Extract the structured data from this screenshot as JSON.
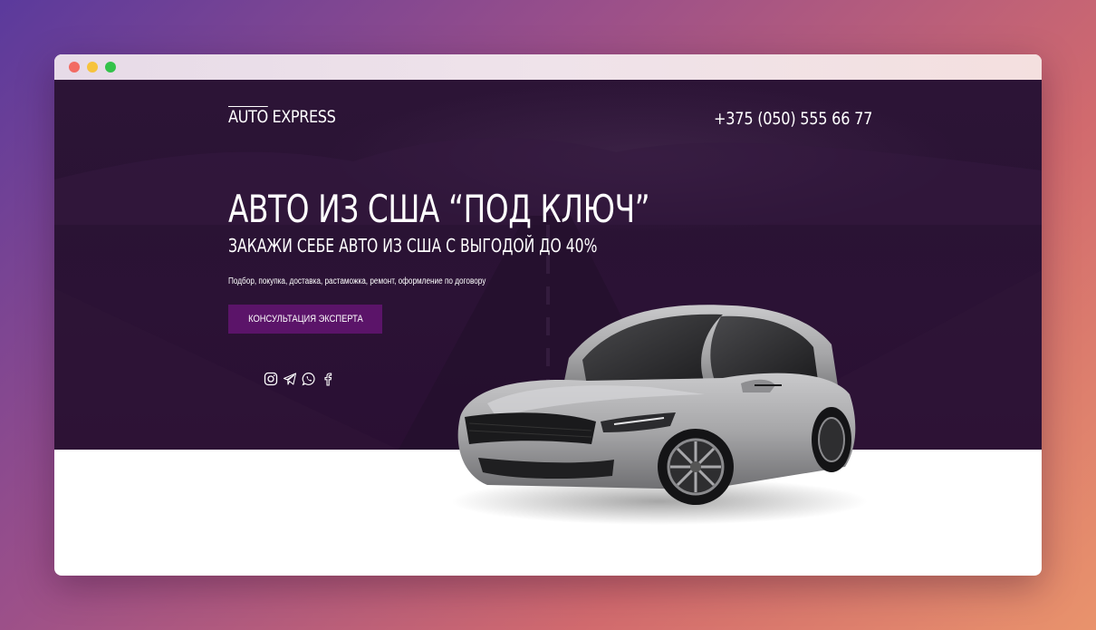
{
  "site": {
    "logo": {
      "part1": "AUTO",
      "part2": " EXPRESS"
    },
    "phone": "+375 (050) 555 66 77"
  },
  "hero": {
    "headline": "АВТО ИЗ США “ПОД КЛЮЧ”",
    "subheadline": "ЗАКАЖИ СЕБЕ АВТО ИЗ США С ВЫГОДОЙ ДО 40%",
    "services": "Подбор, покупка, доставка, растаможка, ремонт, оформление по договору",
    "cta_label": "КОНСУЛЬТАЦИЯ ЭКСПЕРТА"
  },
  "socials": [
    "instagram-icon",
    "telegram-icon",
    "whatsapp-icon",
    "facebook-icon"
  ],
  "colors": {
    "hero_bg": "#2b1235",
    "cta_bg": "#5b1469",
    "text": "#ffffff",
    "car_body": "#a9a9ab"
  }
}
